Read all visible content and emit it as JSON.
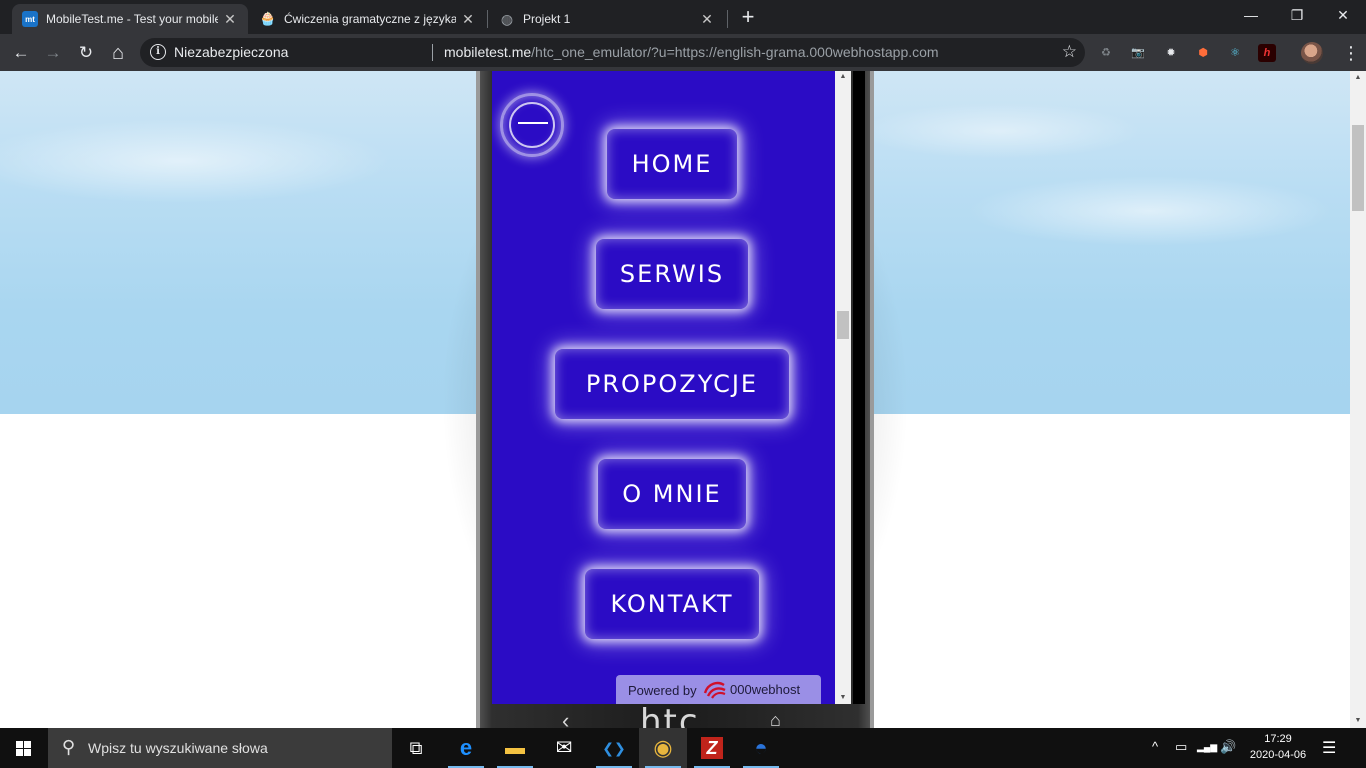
{
  "browser": {
    "tabs": [
      {
        "title": "MobileTest.me - Test your mobile",
        "favicon_text": "mt",
        "favicon_color": "#1a73c8",
        "active": true
      },
      {
        "title": "Ćwiczenia gramatyczne z języka a",
        "favicon_text": "🧁",
        "favicon_color": "#f3c6d3",
        "active": false
      },
      {
        "title": "Projekt 1",
        "favicon_text": "◍",
        "favicon_color": "#5f6368",
        "active": false
      }
    ],
    "close_glyph": "✕",
    "new_tab_glyph": "+",
    "window_controls": {
      "minimize": "—",
      "restore": "❐",
      "close": "✕"
    },
    "nav": {
      "back": "←",
      "forward": "→",
      "reload": "↻",
      "home": "⌂"
    },
    "omnibox": {
      "security_label": "Niezabezpieczona",
      "url_host": "mobiletest.me",
      "url_path": "/htc_one_emulator/?u=https://english-grama.000webhostapp.com",
      "bookmark_glyph": "☆"
    },
    "extensions": [
      "♻",
      "📷",
      "✹",
      "⬢",
      "⚛",
      "h"
    ],
    "menu_glyph": "⋮"
  },
  "phone": {
    "brand": "htc",
    "nav_back": "‹",
    "nav_home": "⌂",
    "menu_items": [
      {
        "label": "HOME"
      },
      {
        "label": "SERWIS"
      },
      {
        "label": "PROPOZYCJE"
      },
      {
        "label": "O MNIE"
      },
      {
        "label": "KONTAKT"
      }
    ],
    "powered_by": "Powered by",
    "host_brand": "000webhost"
  },
  "scroll_glyphs": {
    "up": "▲",
    "down": "▼"
  },
  "taskbar": {
    "search_placeholder": "Wpisz tu wyszukiwane słowa",
    "apps": [
      {
        "name": "task-view",
        "glyph": "⧉",
        "color": "#ffffff"
      },
      {
        "name": "edge",
        "glyph": "e",
        "color": "#1e90ff"
      },
      {
        "name": "file-explorer",
        "glyph": "▬",
        "color": "#f4c242"
      },
      {
        "name": "mail",
        "glyph": "✉",
        "color": "#ffffff"
      },
      {
        "name": "vscode",
        "glyph": "❮❯",
        "color": "#2f8fe0"
      },
      {
        "name": "chrome",
        "glyph": "◉",
        "color": "#e9b73e"
      },
      {
        "name": "filezilla",
        "glyph": "Z",
        "color": "#c0241b"
      },
      {
        "name": "firefox",
        "glyph": "◓",
        "color": "#2a73d9"
      }
    ],
    "tray": {
      "chevron": "^",
      "battery": "▭",
      "network": "▂▄▆",
      "volume": "🔊"
    },
    "time": "17:29",
    "date": "2020-04-06",
    "notifications_glyph": "☰"
  }
}
